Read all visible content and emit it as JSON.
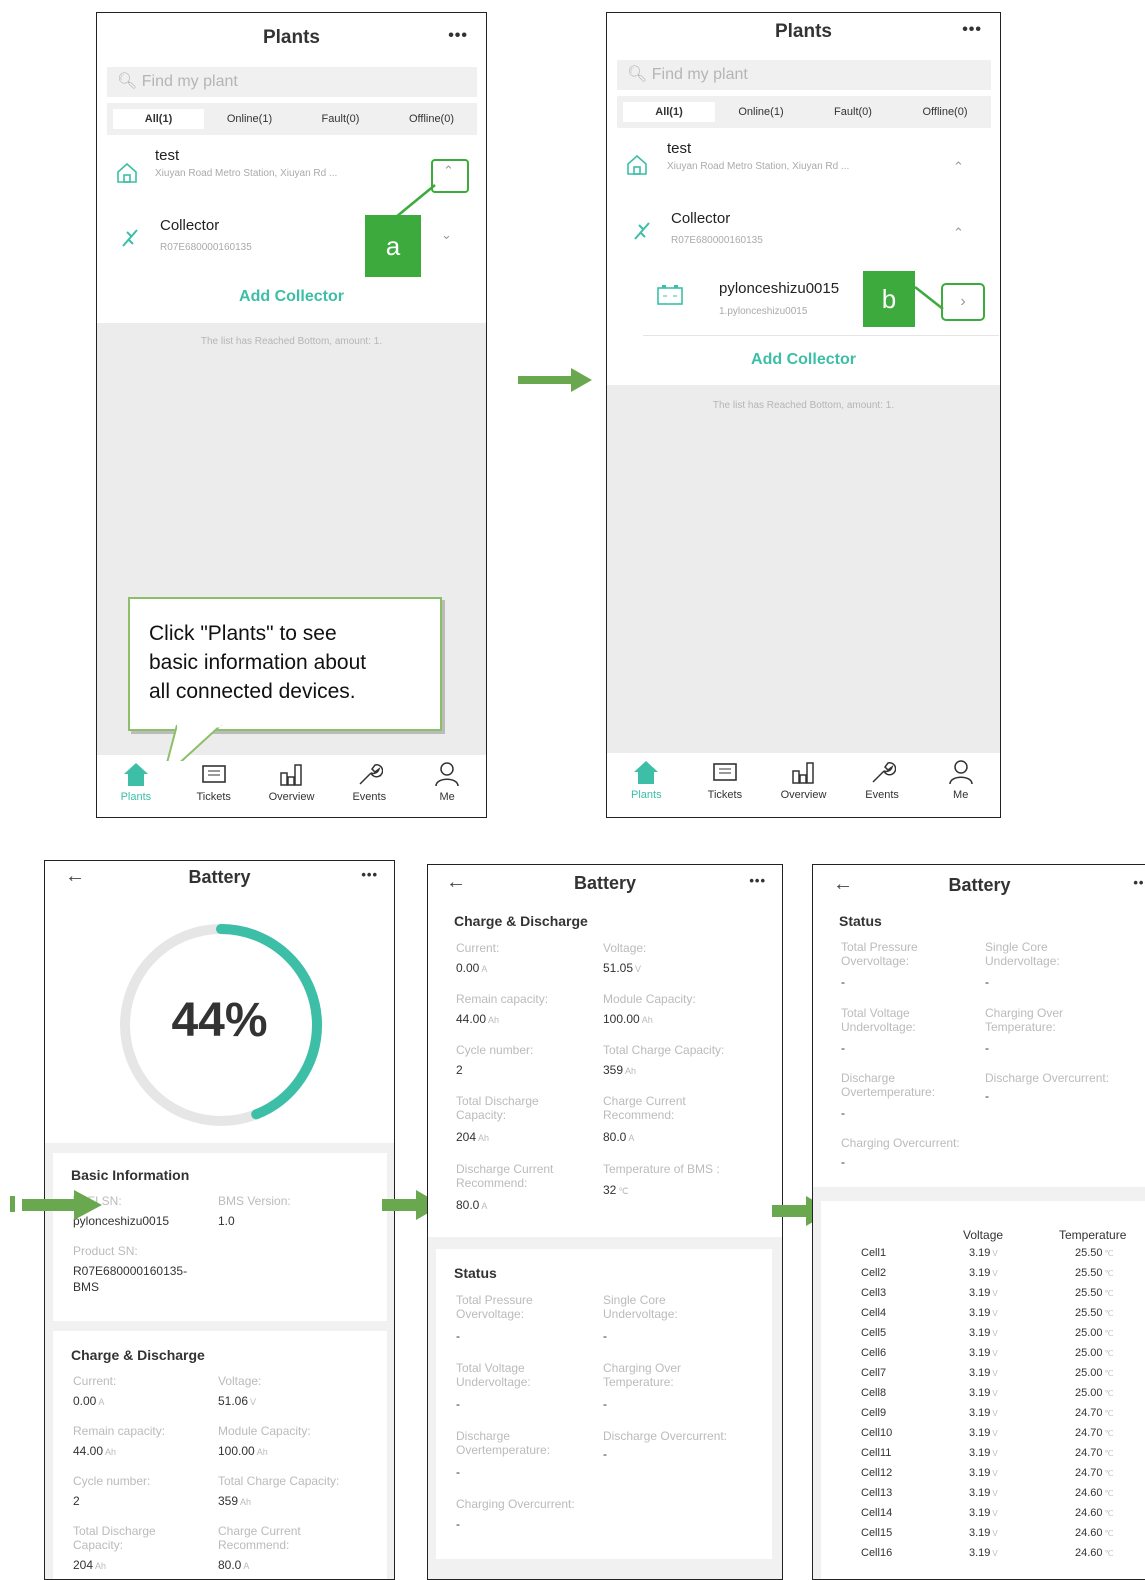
{
  "colors": {
    "accent": "#3cbfa6",
    "annotation_green": "#3caa3c",
    "arrow_green": "#6aa84f"
  },
  "plants_screen": {
    "title": "Plants",
    "menu": "•••",
    "search_placeholder": "Find my plant",
    "tabs": [
      "All(1)",
      "Online(1)",
      "Fault(0)",
      "Offline(0)"
    ],
    "plant": {
      "name": "test",
      "address": "Xiuyan Road Metro Station, Xiuyan Rd ..."
    },
    "collector": {
      "name": "Collector",
      "sn": "R07E680000160135"
    },
    "device": {
      "name": "pylonceshizu0015",
      "sub": "1.pylonceshizu0015"
    },
    "add_collector": "Add Collector",
    "list_end": "The list has Reached Bottom, amount: 1.",
    "nav": [
      "Plants",
      "Tickets",
      "Overview",
      "Events",
      "Me"
    ]
  },
  "annotations": {
    "a": "a",
    "b": "b",
    "callout": [
      "Click \"Plants\" to see",
      "basic information about",
      "all connected devices."
    ]
  },
  "battery_screen": {
    "title": "Battery",
    "menu": "•••",
    "back": "←",
    "soc": "44%",
    "soc_value": 0.44,
    "basic": {
      "title": "Basic Information",
      "wifi_sn_label": "WIFI SN:",
      "wifi_sn": "pylonceshizu0015",
      "bms_label": "BMS Version:",
      "bms": "1.0",
      "product_sn_label": "Product SN:",
      "product_sn_1": "R07E680000160135-",
      "product_sn_2": "BMS"
    },
    "charge": {
      "title": "Charge & Discharge",
      "current_label": "Current:",
      "current": "0.00",
      "current_unit": "A",
      "voltage_label": "Voltage:",
      "voltage": "51.06",
      "voltage_unit": "V",
      "voltage2": "51.05",
      "remain_label": "Remain capacity:",
      "remain": "44.00",
      "remain_unit": "Ah",
      "module_label": "Module Capacity:",
      "module": "100.00",
      "module_unit": "Ah",
      "cycle_label": "Cycle number:",
      "cycle": "2",
      "total_charge_label": "Total Charge Capacity:",
      "total_charge": "359",
      "total_charge_unit": "Ah",
      "total_discharge_label_1": "Total Discharge",
      "total_discharge_label_2": "Capacity:",
      "total_discharge": "204",
      "total_discharge_unit": "Ah",
      "charge_rec_label_1": "Charge Current",
      "charge_rec_label_2": "Recommend:",
      "charge_rec": "80.0",
      "charge_rec_unit": "A",
      "discharge_rec_label_1": "Discharge Current",
      "discharge_rec_label_2": "Recommend:",
      "discharge_rec": "80.0",
      "discharge_rec_unit": "A",
      "bms_temp_label": "Temperature of BMS :",
      "bms_temp": "32",
      "bms_temp_unit": "℃"
    },
    "status": {
      "title": "Status",
      "tpo_1": "Total Pressure",
      "tpo_2": "Overvoltage:",
      "scu_1": "Single Core",
      "scu_2": "Undervoltage:",
      "tvu_1": "Total Voltage",
      "tvu_2": "Undervoltage:",
      "cot_1": "Charging Over",
      "cot_2": "Temperature:",
      "dot_1": "Discharge",
      "dot_2": "Overtemperature:",
      "doc": "Discharge Overcurrent:",
      "coc": "Charging Overcurrent:",
      "dash": "-"
    },
    "cells": {
      "voltage_header": "Voltage",
      "temp_header": "Temperature",
      "v_unit": "V",
      "t_unit": "℃",
      "rows": [
        [
          "Cell1",
          "3.19",
          "25.50"
        ],
        [
          "Cell2",
          "3.19",
          "25.50"
        ],
        [
          "Cell3",
          "3.19",
          "25.50"
        ],
        [
          "Cell4",
          "3.19",
          "25.50"
        ],
        [
          "Cell5",
          "3.19",
          "25.00"
        ],
        [
          "Cell6",
          "3.19",
          "25.00"
        ],
        [
          "Cell7",
          "3.19",
          "25.00"
        ],
        [
          "Cell8",
          "3.19",
          "25.00"
        ],
        [
          "Cell9",
          "3.19",
          "24.70"
        ],
        [
          "Cell10",
          "3.19",
          "24.70"
        ],
        [
          "Cell11",
          "3.19",
          "24.70"
        ],
        [
          "Cell12",
          "3.19",
          "24.70"
        ],
        [
          "Cell13",
          "3.19",
          "24.60"
        ],
        [
          "Cell14",
          "3.19",
          "24.60"
        ],
        [
          "Cell15",
          "3.19",
          "24.60"
        ],
        [
          "Cell16",
          "3.19",
          "24.60"
        ]
      ]
    }
  }
}
